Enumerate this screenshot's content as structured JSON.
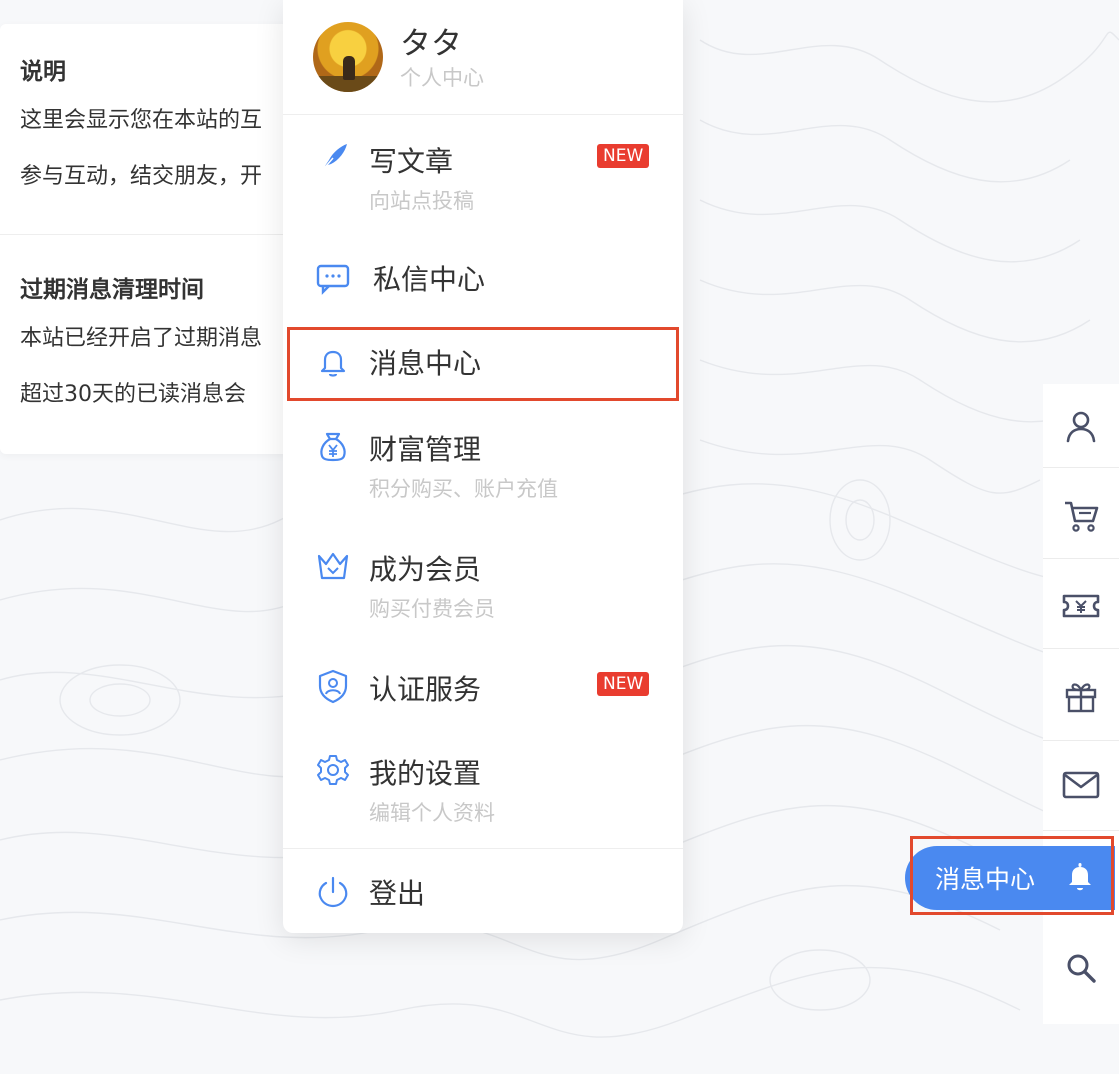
{
  "info_card": {
    "section1": {
      "title": "说明",
      "line1": "这里会显示您在本站的互",
      "line2": "参与互动，结交朋友，开"
    },
    "section2": {
      "title": "过期消息清理时间",
      "line1": "本站已经开启了过期消息",
      "line2": "超过30天的已读消息会"
    }
  },
  "menu": {
    "user": {
      "name": "タタ",
      "subtitle": "个人中心"
    },
    "items": [
      {
        "label": "写文章",
        "sub": "向站点投稿",
        "badge": "NEW",
        "icon": "feather-icon"
      },
      {
        "label": "私信中心",
        "sub": "",
        "badge": "",
        "icon": "chat-icon"
      },
      {
        "label": "消息中心",
        "sub": "",
        "badge": "",
        "icon": "bell-icon"
      },
      {
        "label": "财富管理",
        "sub": "积分购买、账户充值",
        "badge": "",
        "icon": "money-bag-icon"
      },
      {
        "label": "成为会员",
        "sub": "购买付费会员",
        "badge": "",
        "icon": "crown-icon"
      },
      {
        "label": "认证服务",
        "sub": "",
        "badge": "NEW",
        "icon": "shield-user-icon"
      },
      {
        "label": "我的设置",
        "sub": "编辑个人资料",
        "badge": "",
        "icon": "gear-icon"
      },
      {
        "label": "登出",
        "sub": "",
        "badge": "",
        "icon": "power-icon"
      }
    ]
  },
  "sidebar": {
    "items": [
      "user-icon",
      "cart-icon",
      "ticket-icon",
      "gift-icon",
      "mail-icon",
      "bell-icon",
      "search-icon"
    ],
    "active_label": "消息中心"
  },
  "colors": {
    "accent": "#4a89f0",
    "badge": "#e93c2f",
    "highlight": "#e2492d"
  }
}
